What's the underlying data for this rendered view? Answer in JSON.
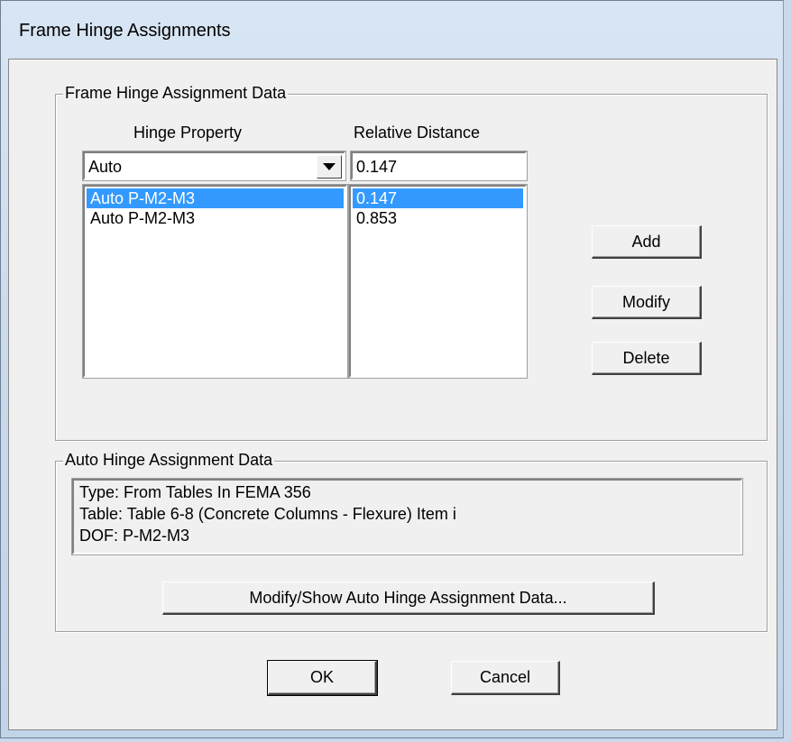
{
  "window": {
    "title": "Frame Hinge Assignments"
  },
  "hinge_group": {
    "legend": "Frame Hinge Assignment Data",
    "hinge_property_label": "Hinge Property",
    "relative_distance_label": "Relative Distance",
    "hinge_property_value": "Auto",
    "relative_distance_value": "0.147",
    "hinge_list": [
      "Auto  P-M2-M3",
      "Auto  P-M2-M3"
    ],
    "distance_list": [
      "0.147",
      "0.853"
    ],
    "selected_index": 0,
    "buttons": {
      "add": "Add",
      "modify": "Modify",
      "delete": "Delete"
    }
  },
  "auto_group": {
    "legend": "Auto Hinge Assignment Data",
    "lines": [
      "Type:  From Tables In FEMA 356",
      "Table:  Table 6-8 (Concrete Columns - Flexure) Item i",
      "DOF:  P-M2-M3"
    ],
    "modify_button": "Modify/Show Auto Hinge Assignment Data..."
  },
  "footer": {
    "ok": "OK",
    "cancel": "Cancel"
  },
  "colors": {
    "selection": "#3399ff",
    "dialog_bg": "#f0f0f0",
    "title_bar": "#c7d8ea"
  },
  "icons": {
    "dropdown": "chevron-down-icon"
  }
}
